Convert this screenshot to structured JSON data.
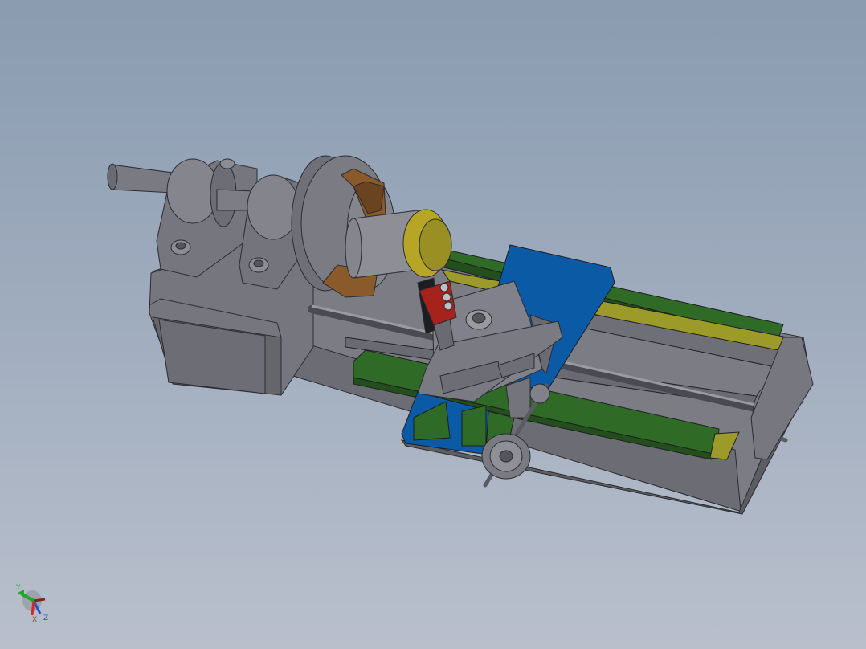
{
  "viewport": {
    "background_top": "#8a9bb0",
    "background_bottom": "#b9c0cc"
  },
  "model": {
    "colors": {
      "body": "#75767d",
      "body_light": "#8a8b92",
      "body_dark": "#55565c",
      "rail_green": "#2f6a26",
      "rail_yellow": "#9c9a28",
      "carriage_blue": "#0b5aa6",
      "jaw_brown": "#8a5a2a",
      "workpiece_gold": "#b7a525",
      "toolholder_red": "#a5221d"
    }
  },
  "triad": {
    "labels": {
      "y": "Y",
      "x": "X",
      "z": "Z"
    },
    "colors": {
      "y": "#22a52b",
      "x": "#d02a2a",
      "z": "#2a4cd6"
    },
    "icon": "axis-triad-icon"
  }
}
